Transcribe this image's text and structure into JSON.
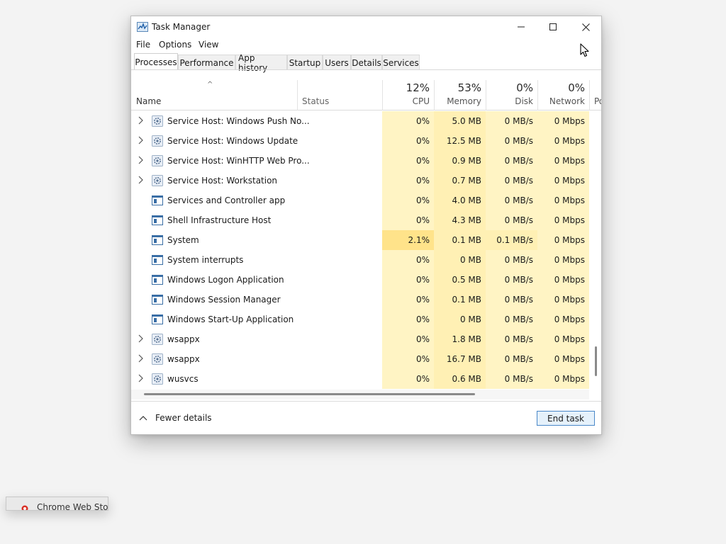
{
  "window": {
    "title": "Task Manager",
    "controls": {
      "minimize": "minimize",
      "maximize": "maximize",
      "close": "close"
    }
  },
  "menu": [
    "File",
    "Options",
    "View"
  ],
  "tabs": [
    {
      "label": "Processes",
      "active": true
    },
    {
      "label": "Performance",
      "active": false
    },
    {
      "label": "App history",
      "active": false
    },
    {
      "label": "Startup",
      "active": false
    },
    {
      "label": "Users",
      "active": false
    },
    {
      "label": "Details",
      "active": false
    },
    {
      "label": "Services",
      "active": false
    }
  ],
  "columns": {
    "name": "Name",
    "status": "Status",
    "cpu": {
      "pct": "12%",
      "label": "CPU"
    },
    "memory": {
      "pct": "53%",
      "label": "Memory"
    },
    "disk": {
      "pct": "0%",
      "label": "Disk"
    },
    "network": {
      "pct": "0%",
      "label": "Network"
    },
    "power": "Po"
  },
  "processes": [
    {
      "name": "Service Host: Windows Push No...",
      "expandable": true,
      "icon": "gear-icon",
      "cpu": "0%",
      "memory": "5.0 MB",
      "disk": "0 MB/s",
      "network": "0 Mbps"
    },
    {
      "name": "Service Host: Windows Update",
      "expandable": true,
      "icon": "gear-icon",
      "cpu": "0%",
      "memory": "12.5 MB",
      "disk": "0 MB/s",
      "network": "0 Mbps"
    },
    {
      "name": "Service Host: WinHTTP Web Pro...",
      "expandable": true,
      "icon": "gear-icon",
      "cpu": "0%",
      "memory": "0.9 MB",
      "disk": "0 MB/s",
      "network": "0 Mbps"
    },
    {
      "name": "Service Host: Workstation",
      "expandable": true,
      "icon": "gear-icon",
      "cpu": "0%",
      "memory": "0.7 MB",
      "disk": "0 MB/s",
      "network": "0 Mbps"
    },
    {
      "name": "Services and Controller app",
      "expandable": false,
      "icon": "app-window-icon",
      "cpu": "0%",
      "memory": "4.0 MB",
      "disk": "0 MB/s",
      "network": "0 Mbps"
    },
    {
      "name": "Shell Infrastructure Host",
      "expandable": false,
      "icon": "app-window-icon",
      "cpu": "0%",
      "memory": "4.3 MB",
      "disk": "0 MB/s",
      "network": "0 Mbps"
    },
    {
      "name": "System",
      "expandable": false,
      "icon": "app-window-icon",
      "cpu": "2.1%",
      "memory": "0.1 MB",
      "disk": "0.1 MB/s",
      "network": "0 Mbps"
    },
    {
      "name": "System interrupts",
      "expandable": false,
      "icon": "app-window-icon",
      "cpu": "0%",
      "memory": "0 MB",
      "disk": "0 MB/s",
      "network": "0 Mbps"
    },
    {
      "name": "Windows Logon Application",
      "expandable": false,
      "icon": "app-window-icon",
      "cpu": "0%",
      "memory": "0.5 MB",
      "disk": "0 MB/s",
      "network": "0 Mbps"
    },
    {
      "name": "Windows Session Manager",
      "expandable": false,
      "icon": "app-window-icon",
      "cpu": "0%",
      "memory": "0.1 MB",
      "disk": "0 MB/s",
      "network": "0 Mbps"
    },
    {
      "name": "Windows Start-Up Application",
      "expandable": false,
      "icon": "app-window-icon",
      "cpu": "0%",
      "memory": "0 MB",
      "disk": "0 MB/s",
      "network": "0 Mbps"
    },
    {
      "name": "wsappx",
      "expandable": true,
      "icon": "gear-icon",
      "cpu": "0%",
      "memory": "1.8 MB",
      "disk": "0 MB/s",
      "network": "0 Mbps"
    },
    {
      "name": "wsappx",
      "expandable": true,
      "icon": "gear-icon",
      "cpu": "0%",
      "memory": "16.7 MB",
      "disk": "0 MB/s",
      "network": "0 Mbps"
    },
    {
      "name": "wusvcs",
      "expandable": true,
      "icon": "gear-icon",
      "cpu": "0%",
      "memory": "0.6 MB",
      "disk": "0 MB/s",
      "network": "0 Mbps"
    }
  ],
  "footer": {
    "fewer_details": "Fewer details",
    "end_task": "End task"
  },
  "taskbar_tooltip": {
    "label": "Chrome Web Store",
    "icon": "chrome-web-store-icon"
  },
  "colors": {
    "heat_light": "#fff4c4",
    "heat_medium": "#fff0b4",
    "heat_strong": "#ffe38a",
    "accent_border": "#4a88c8",
    "button_bg": "#e5f1fb"
  }
}
